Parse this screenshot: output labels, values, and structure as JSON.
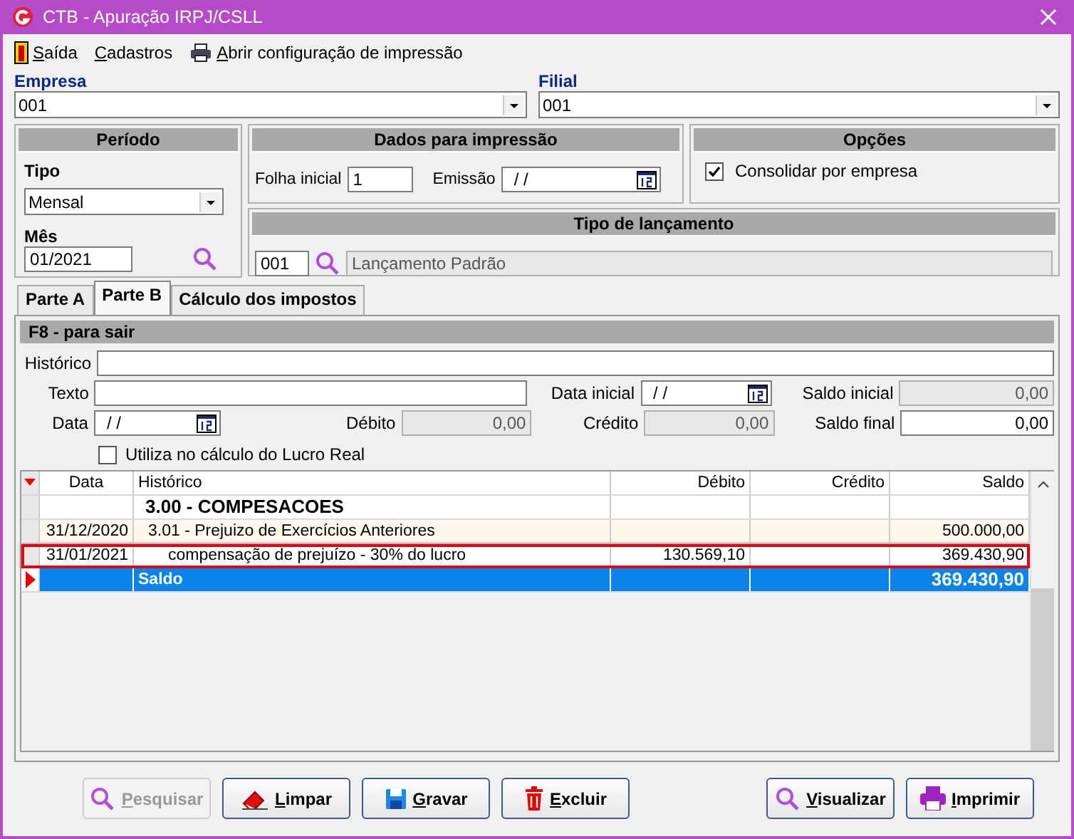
{
  "window": {
    "title": "CTB - Apuração IRPJ/CSLL"
  },
  "menu": [
    {
      "label": "Saída"
    },
    {
      "label": "Cadastros"
    },
    {
      "label": "Abrir configuração de impressão"
    }
  ],
  "empresa": {
    "label": "Empresa",
    "value": "001"
  },
  "filial": {
    "label": "Filial",
    "value": "001"
  },
  "periodo": {
    "title": "Período",
    "tipo_label": "Tipo",
    "tipo_value": "Mensal",
    "mes_label": "Mês",
    "mes_value": "01/2021"
  },
  "dados_impressao": {
    "title": "Dados para impressão",
    "folha_label": "Folha inicial",
    "folha_value": "1",
    "emissao_label": "Emissão",
    "emissao_value": "/ /"
  },
  "opcoes": {
    "title": "Opções",
    "checkbox": {
      "label": "Consolidar por empresa",
      "checked": true
    }
  },
  "tipo_lancamento": {
    "title": "Tipo de lançamento",
    "code": "001",
    "description": "Lançamento Padrão"
  },
  "tabs": [
    {
      "label": "Parte A",
      "selected": false
    },
    {
      "label": "Parte B",
      "selected": true
    },
    {
      "label": "Cálculo dos impostos",
      "selected": false
    }
  ],
  "panel": {
    "title": "F8 - para sair",
    "historico_label": "Histórico",
    "texto_label": "Texto",
    "data_label": "Data",
    "data_value": "/ /",
    "debito_label": "Débito",
    "debito_value": "0,00",
    "data_inicial_label": "Data inicial",
    "data_inicial_value": "/ /",
    "credito_label": "Crédito",
    "credito_value": "0,00",
    "saldo_inicial_label": "Saldo inicial",
    "saldo_inicial_value": "0,00",
    "saldo_final_label": "Saldo final",
    "saldo_final_value": "0,00",
    "checkbox": {
      "label": "Utiliza no cálculo do Lucro Real",
      "checked": false
    }
  },
  "table": {
    "columns": [
      "Data",
      "Histórico",
      "Débito",
      "Crédito",
      "Saldo"
    ],
    "rows": [
      {
        "kind": "group",
        "cells": [
          "",
          "3.00 - COMPESACOES",
          "",
          "",
          ""
        ],
        "selected": false,
        "highlighted": false
      },
      {
        "kind": "entry",
        "cells": [
          "31/12/2020",
          "3.01 - Prejuizo de Exercícios Anteriores",
          "",
          "",
          "500.000,00"
        ],
        "selected": false,
        "highlighted": false
      },
      {
        "kind": "detail",
        "cells": [
          "31/01/2021",
          "compensação de prejuízo - 30% do lucro",
          "130.569,10",
          "",
          "369.430,90"
        ],
        "selected": false,
        "highlighted": true
      },
      {
        "kind": "total",
        "cells": [
          "",
          "Saldo",
          "",
          "",
          "369.430,90"
        ],
        "selected": true,
        "highlighted": false
      }
    ]
  },
  "buttons": [
    {
      "label": "Pesquisar",
      "disabled": true
    },
    {
      "label": "Limpar",
      "disabled": false
    },
    {
      "label": "Gravar",
      "disabled": false
    },
    {
      "label": "Excluir",
      "disabled": false
    },
    {
      "label": "Visualizar",
      "disabled": false
    },
    {
      "label": "Imprimir",
      "disabled": false
    }
  ]
}
